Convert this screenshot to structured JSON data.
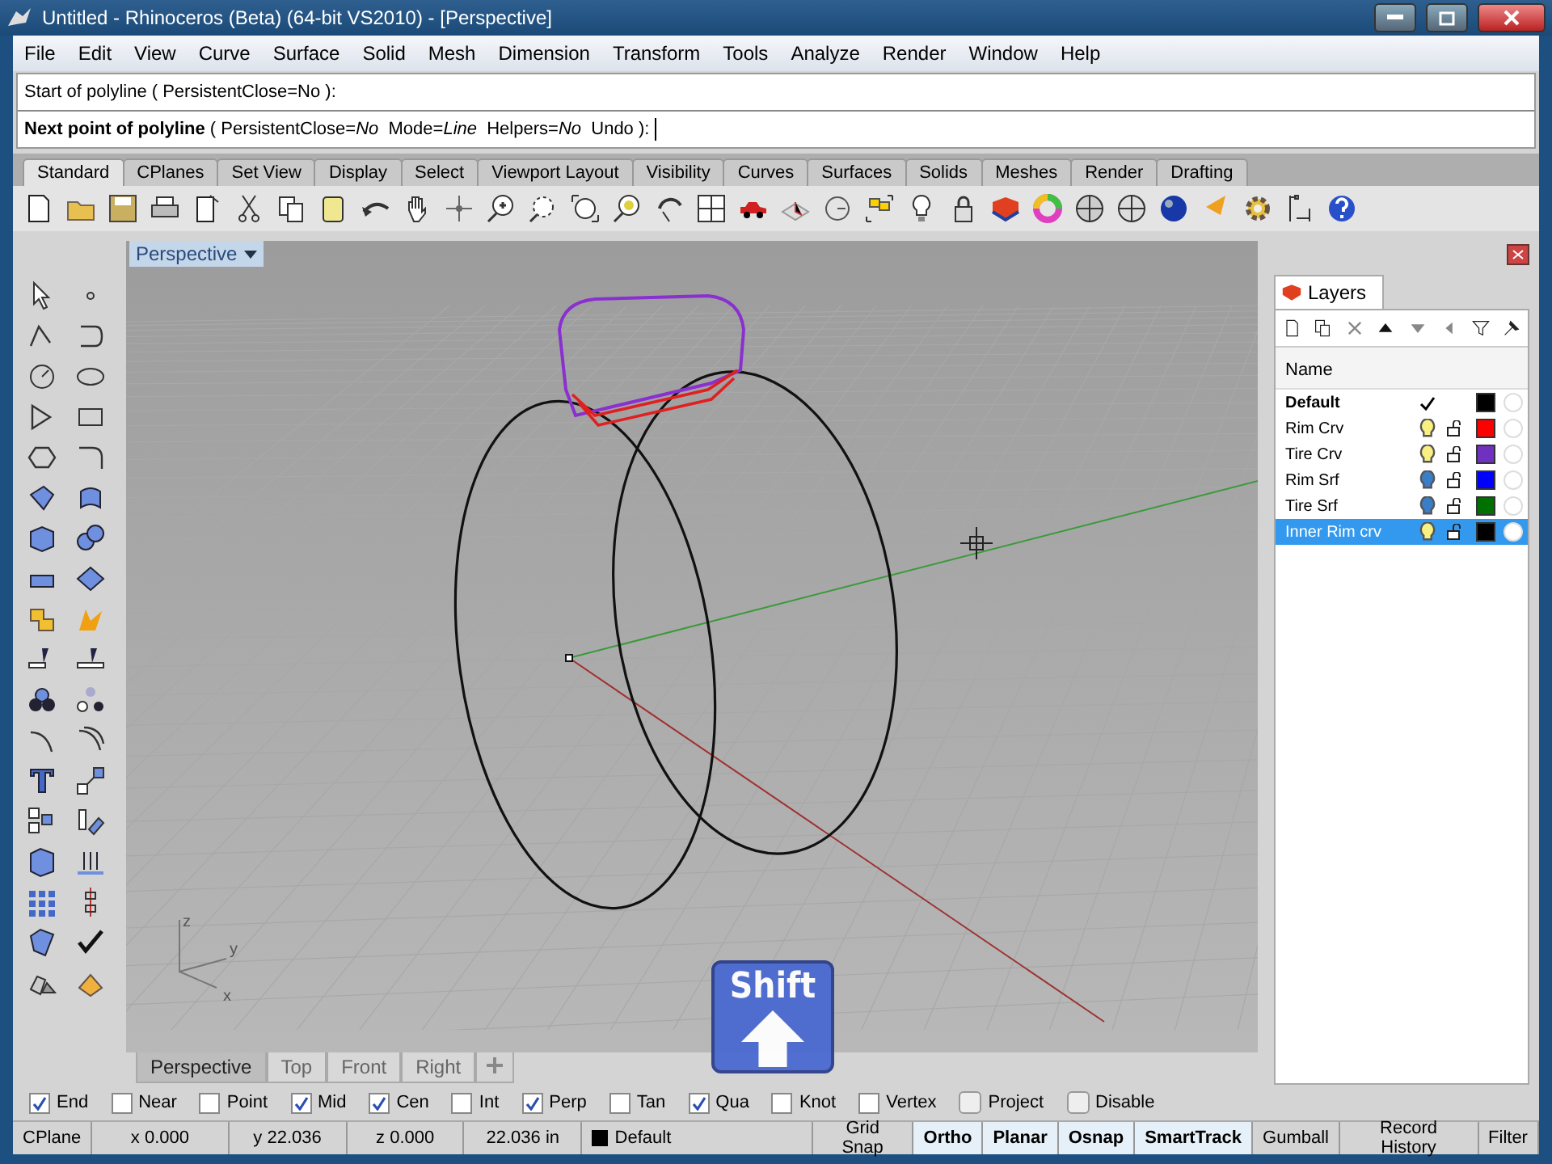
{
  "window": {
    "title": "Untitled - Rhinoceros (Beta) (64-bit VS2010) - [Perspective]"
  },
  "menu": [
    "File",
    "Edit",
    "View",
    "Curve",
    "Surface",
    "Solid",
    "Mesh",
    "Dimension",
    "Transform",
    "Tools",
    "Analyze",
    "Render",
    "Window",
    "Help"
  ],
  "command": {
    "history": "Start of polyline ( PersistentClose=No ):",
    "prompt": "**Next point of polyline** ( PersistentClose=*No*  Mode=*Line*  Helpers=*No*  Undo ):"
  },
  "toolbar_tabs": [
    {
      "label": "Standard",
      "selected": true
    },
    {
      "label": "CPlanes",
      "selected": false
    },
    {
      "label": "Set View",
      "selected": false
    },
    {
      "label": "Display",
      "selected": false
    },
    {
      "label": "Select",
      "selected": false
    },
    {
      "label": "Viewport Layout",
      "selected": false
    },
    {
      "label": "Visibility",
      "selected": false
    },
    {
      "label": "Curves",
      "selected": false
    },
    {
      "label": "Surfaces",
      "selected": false
    },
    {
      "label": "Solids",
      "selected": false
    },
    {
      "label": "Meshes",
      "selected": false
    },
    {
      "label": "Render",
      "selected": false
    },
    {
      "label": "Drafting",
      "selected": false
    }
  ],
  "viewport": {
    "title": "Perspective",
    "axis_labels": [
      "z",
      "y",
      "x"
    ],
    "tabs": [
      {
        "label": "Perspective",
        "selected": true
      },
      {
        "label": "Top",
        "selected": false
      },
      {
        "label": "Front",
        "selected": false
      },
      {
        "label": "Right",
        "selected": false
      }
    ]
  },
  "layers_panel": {
    "title": "Layers",
    "column": "Name",
    "layers": [
      {
        "name": "Default",
        "current": true,
        "color": "#000000",
        "selected": false
      },
      {
        "name": "Rim Crv",
        "current": false,
        "on": true,
        "color": "#ff0000",
        "selected": false
      },
      {
        "name": "Tire Crv",
        "current": false,
        "on": true,
        "color": "#7030c0",
        "selected": false
      },
      {
        "name": "Rim Srf",
        "current": false,
        "on": false,
        "color": "#0000ff",
        "selected": false
      },
      {
        "name": "Tire Srf",
        "current": false,
        "on": false,
        "color": "#007000",
        "selected": false
      },
      {
        "name": "Inner Rim crv",
        "current": false,
        "on": true,
        "color": "#000000",
        "selected": true
      }
    ]
  },
  "osnaps": [
    {
      "label": "End",
      "kind": "check",
      "checked": true
    },
    {
      "label": "Near",
      "kind": "check",
      "checked": false
    },
    {
      "label": "Point",
      "kind": "check",
      "checked": false
    },
    {
      "label": "Mid",
      "kind": "check",
      "checked": true
    },
    {
      "label": "Cen",
      "kind": "check",
      "checked": true
    },
    {
      "label": "Int",
      "kind": "check",
      "checked": false
    },
    {
      "label": "Perp",
      "kind": "check",
      "checked": true
    },
    {
      "label": "Tan",
      "kind": "check",
      "checked": false
    },
    {
      "label": "Qua",
      "kind": "check",
      "checked": true
    },
    {
      "label": "Knot",
      "kind": "check",
      "checked": false
    },
    {
      "label": "Vertex",
      "kind": "check",
      "checked": false
    },
    {
      "label": "Project",
      "kind": "toggle",
      "checked": false
    },
    {
      "label": "Disable",
      "kind": "toggle",
      "checked": false
    }
  ],
  "status_bar": {
    "cplane": "CPlane",
    "x": "x 0.000",
    "y": "y 22.036",
    "z": "z 0.000",
    "distance": "22.036 in",
    "layer": "Default",
    "toggles": [
      {
        "label": "Grid Snap",
        "on": false
      },
      {
        "label": "Ortho",
        "on": true
      },
      {
        "label": "Planar",
        "on": true
      },
      {
        "label": "Osnap",
        "on": true
      },
      {
        "label": "SmartTrack",
        "on": true
      },
      {
        "label": "Gumball",
        "on": false
      },
      {
        "label": "Record History",
        "on": false
      },
      {
        "label": "Filter",
        "on": false
      }
    ]
  },
  "key_overlay": {
    "label": "Shift"
  }
}
